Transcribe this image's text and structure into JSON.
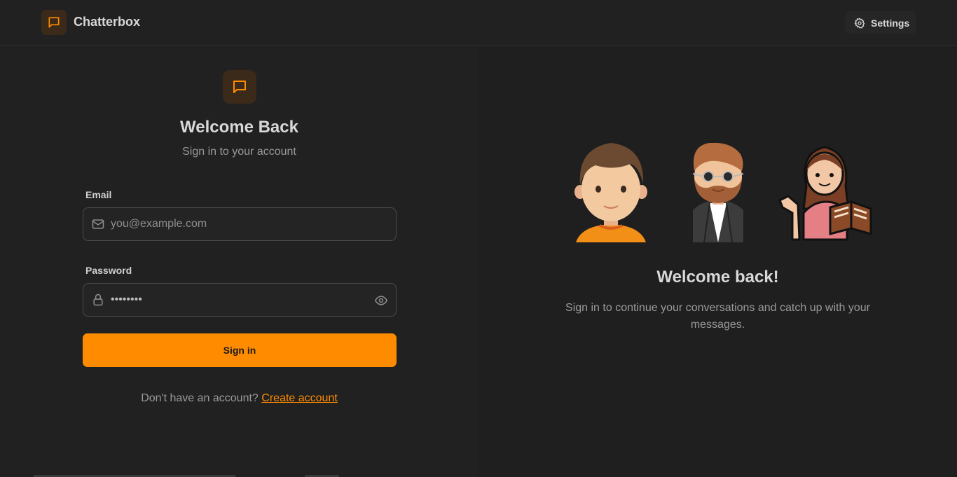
{
  "header": {
    "app_name": "Chatterbox",
    "settings_label": "Settings"
  },
  "form": {
    "title": "Welcome Back",
    "subtitle": "Sign in to your account",
    "email_label": "Email",
    "email_placeholder": "you@example.com",
    "email_value": "",
    "password_label": "Password",
    "password_value": "••••••••",
    "signin_label": "Sign in",
    "signup_prompt": "Don't have an account?",
    "signup_link": "Create account"
  },
  "hero": {
    "title": "Welcome back!",
    "subtitle": "Sign in to continue your conversations and catch up with your messages."
  },
  "icons": {
    "brand": "message-square-icon",
    "settings": "gear-icon",
    "email": "mail-icon",
    "password": "lock-icon",
    "reveal": "eye-icon"
  },
  "colors": {
    "accent": "#ff8c00",
    "background": "#212121",
    "logo_bg": "#3b2a1a"
  }
}
